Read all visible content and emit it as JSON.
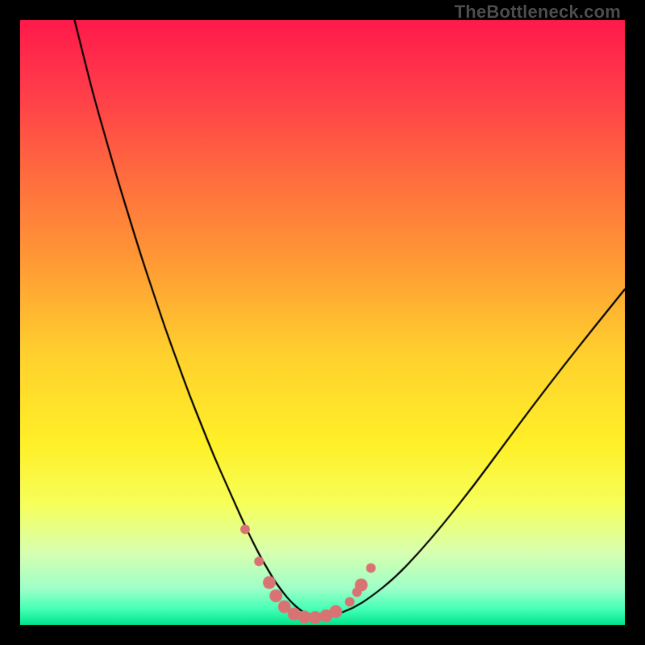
{
  "watermark": "TheBottleneck.com",
  "chart_data": {
    "type": "line",
    "title": "",
    "xlabel": "",
    "ylabel": "",
    "xlim": [
      0,
      100
    ],
    "ylim": [
      0,
      100
    ],
    "grid": false,
    "legend": null,
    "background_gradient": {
      "stops": [
        {
          "offset": 0.0,
          "color": "#ff1a4b"
        },
        {
          "offset": 0.12,
          "color": "#ff3d4a"
        },
        {
          "offset": 0.25,
          "color": "#ff6a3f"
        },
        {
          "offset": 0.4,
          "color": "#ff9a35"
        },
        {
          "offset": 0.55,
          "color": "#ffd02e"
        },
        {
          "offset": 0.7,
          "color": "#fff028"
        },
        {
          "offset": 0.8,
          "color": "#f7ff5a"
        },
        {
          "offset": 0.88,
          "color": "#d8ffb0"
        },
        {
          "offset": 0.94,
          "color": "#9effc8"
        },
        {
          "offset": 0.975,
          "color": "#42ffb5"
        },
        {
          "offset": 1.0,
          "color": "#00e58a"
        }
      ]
    },
    "series": [
      {
        "name": "bottleneck-curve",
        "color": "#000000",
        "width": 2.2,
        "x": [
          9,
          10,
          12,
          14,
          16,
          18,
          20,
          22,
          24,
          26,
          28,
          30,
          32,
          34,
          36,
          37,
          38,
          39,
          40,
          41,
          42,
          43,
          44,
          45,
          46,
          47,
          48,
          50,
          52,
          55,
          58,
          62,
          66,
          70,
          75,
          80,
          85,
          90,
          95,
          100
        ],
        "y": [
          100,
          96,
          88,
          81,
          74,
          67.5,
          61,
          55,
          49,
          43.5,
          38,
          33,
          28,
          23.5,
          19,
          16.8,
          14.7,
          12.7,
          10.8,
          9.1,
          7.4,
          6,
          4.7,
          3.6,
          2.7,
          2,
          1.6,
          1.3,
          1.65,
          2.7,
          4.6,
          7.8,
          12,
          16.7,
          23,
          29.8,
          36.5,
          43,
          49.3,
          55.5
        ]
      }
    ],
    "markers": {
      "name": "curve-dots",
      "color": "#d97373",
      "radius_small": 6,
      "radius_large": 8,
      "points": [
        {
          "x": 37.2,
          "y": 15.8,
          "r": "small"
        },
        {
          "x": 39.5,
          "y": 10.5,
          "r": "small"
        },
        {
          "x": 41.2,
          "y": 7.0,
          "r": "large"
        },
        {
          "x": 42.3,
          "y": 4.8,
          "r": "large"
        },
        {
          "x": 43.7,
          "y": 3.0,
          "r": "large"
        },
        {
          "x": 45.3,
          "y": 1.8,
          "r": "large"
        },
        {
          "x": 47.0,
          "y": 1.3,
          "r": "large"
        },
        {
          "x": 48.8,
          "y": 1.2,
          "r": "large"
        },
        {
          "x": 50.6,
          "y": 1.5,
          "r": "large"
        },
        {
          "x": 52.2,
          "y": 2.2,
          "r": "large"
        },
        {
          "x": 54.5,
          "y": 3.8,
          "r": "small"
        },
        {
          "x": 55.7,
          "y": 5.4,
          "r": "small"
        },
        {
          "x": 56.4,
          "y": 6.6,
          "r": "large"
        },
        {
          "x": 58.0,
          "y": 9.4,
          "r": "small"
        }
      ]
    }
  }
}
